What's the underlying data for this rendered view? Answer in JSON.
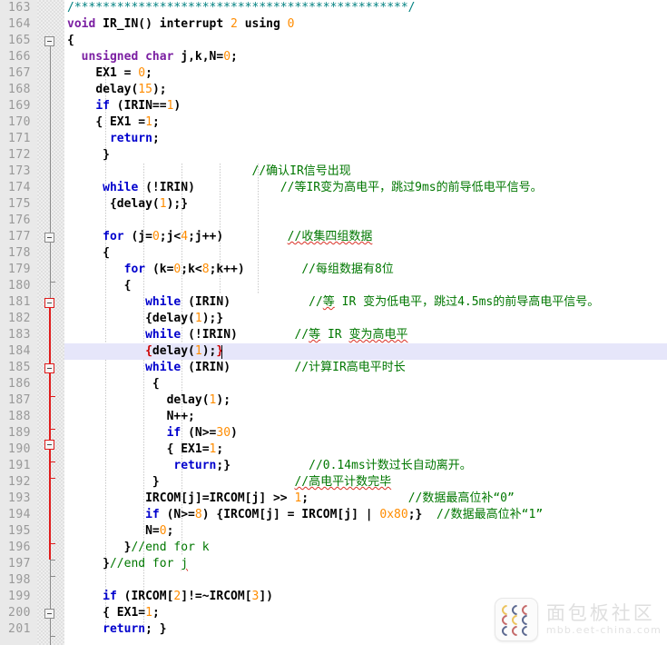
{
  "editor": {
    "first_line": 163,
    "last_line": 201,
    "line_height": 18,
    "highlighted_line": 184,
    "colors": {
      "background": "#ffffff",
      "gutter": "#e9e9e9",
      "linenumber_text": "#999999",
      "keyword": "#0000cd",
      "type_keyword": "#7b1fa2",
      "number": "#ff8c00",
      "comment": "#007700",
      "banner_comment": "#008080",
      "highlight_row": "#e6e6fa",
      "fold_active": "#e01b1b",
      "fold_inactive": "#8a8a8a",
      "spellcheck_squiggle": "#d93025"
    },
    "lines": [
      {
        "n": 163,
        "text": "/***********************************************/"
      },
      {
        "n": 164,
        "text": "void IR_IN() interrupt 2 using 0"
      },
      {
        "n": 165,
        "text": "{"
      },
      {
        "n": 166,
        "text": "  unsigned char j,k,N=0;"
      },
      {
        "n": 167,
        "text": "    EX1 = 0;"
      },
      {
        "n": 168,
        "text": "    delay(15);"
      },
      {
        "n": 169,
        "text": "    if (IRIN==1)"
      },
      {
        "n": 170,
        "text": "    { EX1 =1;"
      },
      {
        "n": 171,
        "text": "      return;"
      },
      {
        "n": 172,
        "text": "     }"
      },
      {
        "n": 173,
        "text": "                          //确认IR信号出现"
      },
      {
        "n": 174,
        "text": "     while (!IRIN)            //等IR变为高电平，跳过9ms的前导低电平信号。"
      },
      {
        "n": 175,
        "text": "      {delay(1);}"
      },
      {
        "n": 176,
        "text": ""
      },
      {
        "n": 177,
        "text": "     for (j=0;j<4;j++)         //收集四组数据"
      },
      {
        "n": 178,
        "text": "     {"
      },
      {
        "n": 179,
        "text": "        for (k=0;k<8;k++)        //每组数据有8位"
      },
      {
        "n": 180,
        "text": "        {"
      },
      {
        "n": 181,
        "text": "           while (IRIN)           //等 IR 变为低电平，跳过4.5ms的前导高电平信号。"
      },
      {
        "n": 182,
        "text": "           {delay(1);}"
      },
      {
        "n": 183,
        "text": "           while (!IRIN)        //等 IR 变为高电平"
      },
      {
        "n": 184,
        "text": "           {delay(1);}"
      },
      {
        "n": 185,
        "text": "           while (IRIN)         //计算IR高电平时长"
      },
      {
        "n": 186,
        "text": "            {"
      },
      {
        "n": 187,
        "text": "              delay(1);"
      },
      {
        "n": 188,
        "text": "              N++;"
      },
      {
        "n": 189,
        "text": "              if (N>=30)"
      },
      {
        "n": 190,
        "text": "              { EX1=1;"
      },
      {
        "n": 191,
        "text": "               return;}           //0.14ms计数过长自动离开。"
      },
      {
        "n": 192,
        "text": "            }                   //高电平计数完毕"
      },
      {
        "n": 193,
        "text": "           IRCOM[j]=IRCOM[j] >> 1;              //数据最高位补“0”"
      },
      {
        "n": 194,
        "text": "           if (N>=8) {IRCOM[j] = IRCOM[j] | 0x80;}  //数据最高位补“1”"
      },
      {
        "n": 195,
        "text": "           N=0;"
      },
      {
        "n": 196,
        "text": "        }//end for k"
      },
      {
        "n": 197,
        "text": "     }//end for j"
      },
      {
        "n": 198,
        "text": ""
      },
      {
        "n": 199,
        "text": "     if (IRCOM[2]!=~IRCOM[3])"
      },
      {
        "n": 200,
        "text": "     { EX1=1;"
      },
      {
        "n": 201,
        "text": "     return; }"
      }
    ],
    "keywords": [
      "void",
      "unsigned",
      "char",
      "if",
      "return",
      "while",
      "for",
      "interrupt",
      "using"
    ],
    "comments_chinese": [
      "//确认IR信号出现",
      "//等IR变为高电平，跳过9ms的前导低电平信号。",
      "//收集四组数据",
      "//每组数据有8位",
      "//等 IR 变为低电平，跳过4.5ms的前导高电平信号。",
      "//等 IR 变为高电平",
      "//计算IR高电平时长",
      "//0.14ms计数过长自动离开。",
      "//高电平计数完毕",
      "//数据最高位补“0”",
      "//数据最高位补“1”"
    ]
  },
  "watermark": {
    "title": "面包板社区",
    "subtitle": "mbb.eet-china.com"
  }
}
